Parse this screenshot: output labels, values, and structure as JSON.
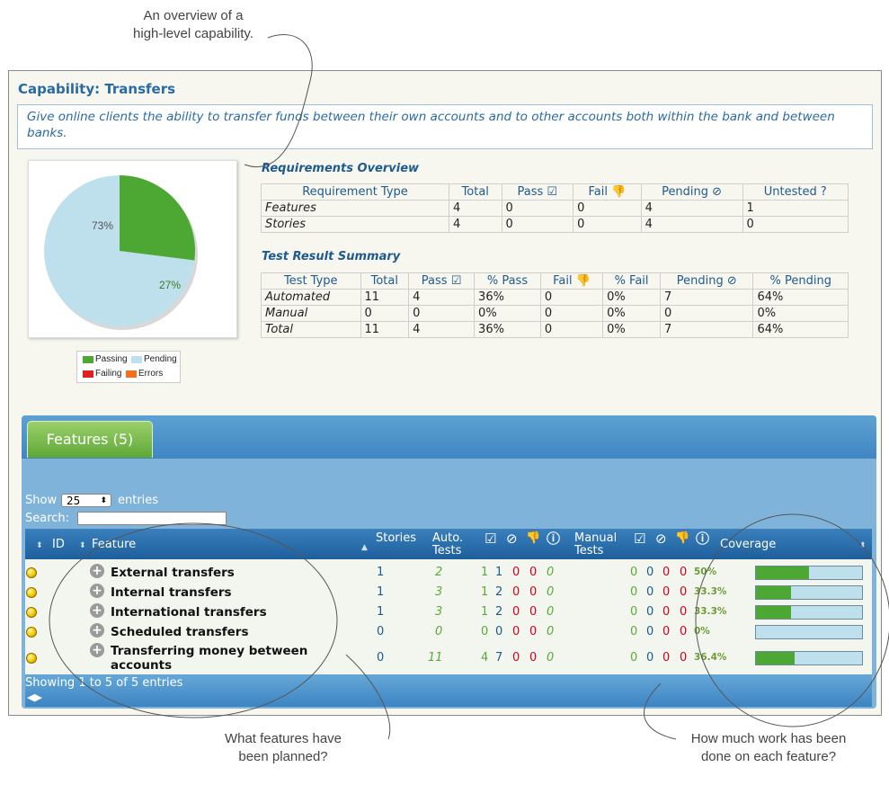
{
  "callouts": {
    "top": "An overview of a\nhigh-level capability.",
    "bottom_left": "What features have\nbeen planned?",
    "bottom_right": "How much work has been\ndone on each feature?"
  },
  "capability": {
    "title": "Capability: Transfers",
    "description": "Give online clients the ability to transfer funds between their own accounts and to other accounts both within the bank and between banks."
  },
  "pie": {
    "slices": [
      {
        "label": "73%",
        "value": 73,
        "color": "#bde0ec"
      },
      {
        "label": "27%",
        "value": 27,
        "color": "#4ca832"
      }
    ],
    "legend": [
      {
        "label": "Passing",
        "color": "#4ca832"
      },
      {
        "label": "Pending",
        "color": "#bde0ec"
      },
      {
        "label": "Failing",
        "color": "#e02020"
      },
      {
        "label": "Errors",
        "color": "#f07020"
      }
    ]
  },
  "requirements": {
    "title": "Requirements Overview",
    "headers": [
      "Requirement Type",
      "Total",
      "Pass ☑",
      "Fail 👎",
      "Pending ⊘",
      "Untested ?"
    ],
    "rows": [
      [
        "Features",
        "4",
        "0",
        "0",
        "4",
        "1"
      ],
      [
        "Stories",
        "4",
        "0",
        "0",
        "4",
        "0"
      ]
    ]
  },
  "test_results": {
    "title": "Test Result Summary",
    "headers": [
      "Test Type",
      "Total",
      "Pass ☑",
      "% Pass",
      "Fail 👎",
      "% Fail",
      "Pending ⊘",
      "% Pending"
    ],
    "rows": [
      [
        "Automated",
        "11",
        "4",
        "36%",
        "0",
        "0%",
        "7",
        "64%"
      ],
      [
        "Manual",
        "0",
        "0",
        "0%",
        "0",
        "0%",
        "0",
        "0%"
      ],
      [
        "Total",
        "11",
        "4",
        "36%",
        "0",
        "0%",
        "7",
        "64%"
      ]
    ]
  },
  "features": {
    "tab_label": "Features (5)",
    "show_label": "Show",
    "entries_value": "25",
    "entries_label": "entries",
    "search_label": "Search:",
    "search_value": "",
    "columns": {
      "id": "ID",
      "feature": "Feature",
      "stories": "Stories",
      "auto_tests": "Auto.\nTests",
      "manual_tests": "Manual\nTests",
      "coverage": "Coverage"
    },
    "rows": [
      {
        "name": "External transfers",
        "stories": "1",
        "auto": "2",
        "a_pass": "1",
        "a_pend": "1",
        "a_fail": "0",
        "a_err": "0",
        "manual": "0",
        "m_pass": "0",
        "m_pend": "0",
        "m_fail": "0",
        "m_err": "0",
        "coverage_label": "50%",
        "coverage": 0.5
      },
      {
        "name": "Internal transfers",
        "stories": "1",
        "auto": "3",
        "a_pass": "1",
        "a_pend": "2",
        "a_fail": "0",
        "a_err": "0",
        "manual": "0",
        "m_pass": "0",
        "m_pend": "0",
        "m_fail": "0",
        "m_err": "0",
        "coverage_label": "33.3%",
        "coverage": 0.333
      },
      {
        "name": "International transfers",
        "stories": "1",
        "auto": "3",
        "a_pass": "1",
        "a_pend": "2",
        "a_fail": "0",
        "a_err": "0",
        "manual": "0",
        "m_pass": "0",
        "m_pend": "0",
        "m_fail": "0",
        "m_err": "0",
        "coverage_label": "33.3%",
        "coverage": 0.333
      },
      {
        "name": "Scheduled transfers",
        "stories": "0",
        "auto": "0",
        "a_pass": "0",
        "a_pend": "0",
        "a_fail": "0",
        "a_err": "0",
        "manual": "0",
        "m_pass": "0",
        "m_pend": "0",
        "m_fail": "0",
        "m_err": "0",
        "coverage_label": "0%",
        "coverage": 0
      },
      {
        "name": "Transferring money between\naccounts",
        "stories": "0",
        "auto": "11",
        "a_pass": "4",
        "a_pend": "7",
        "a_fail": "0",
        "a_err": "0",
        "manual": "0",
        "m_pass": "0",
        "m_pend": "0",
        "m_fail": "0",
        "m_err": "0",
        "coverage_label": "36.4%",
        "coverage": 0.364
      }
    ],
    "footer": "Showing 1 to 5 of 5 entries"
  }
}
